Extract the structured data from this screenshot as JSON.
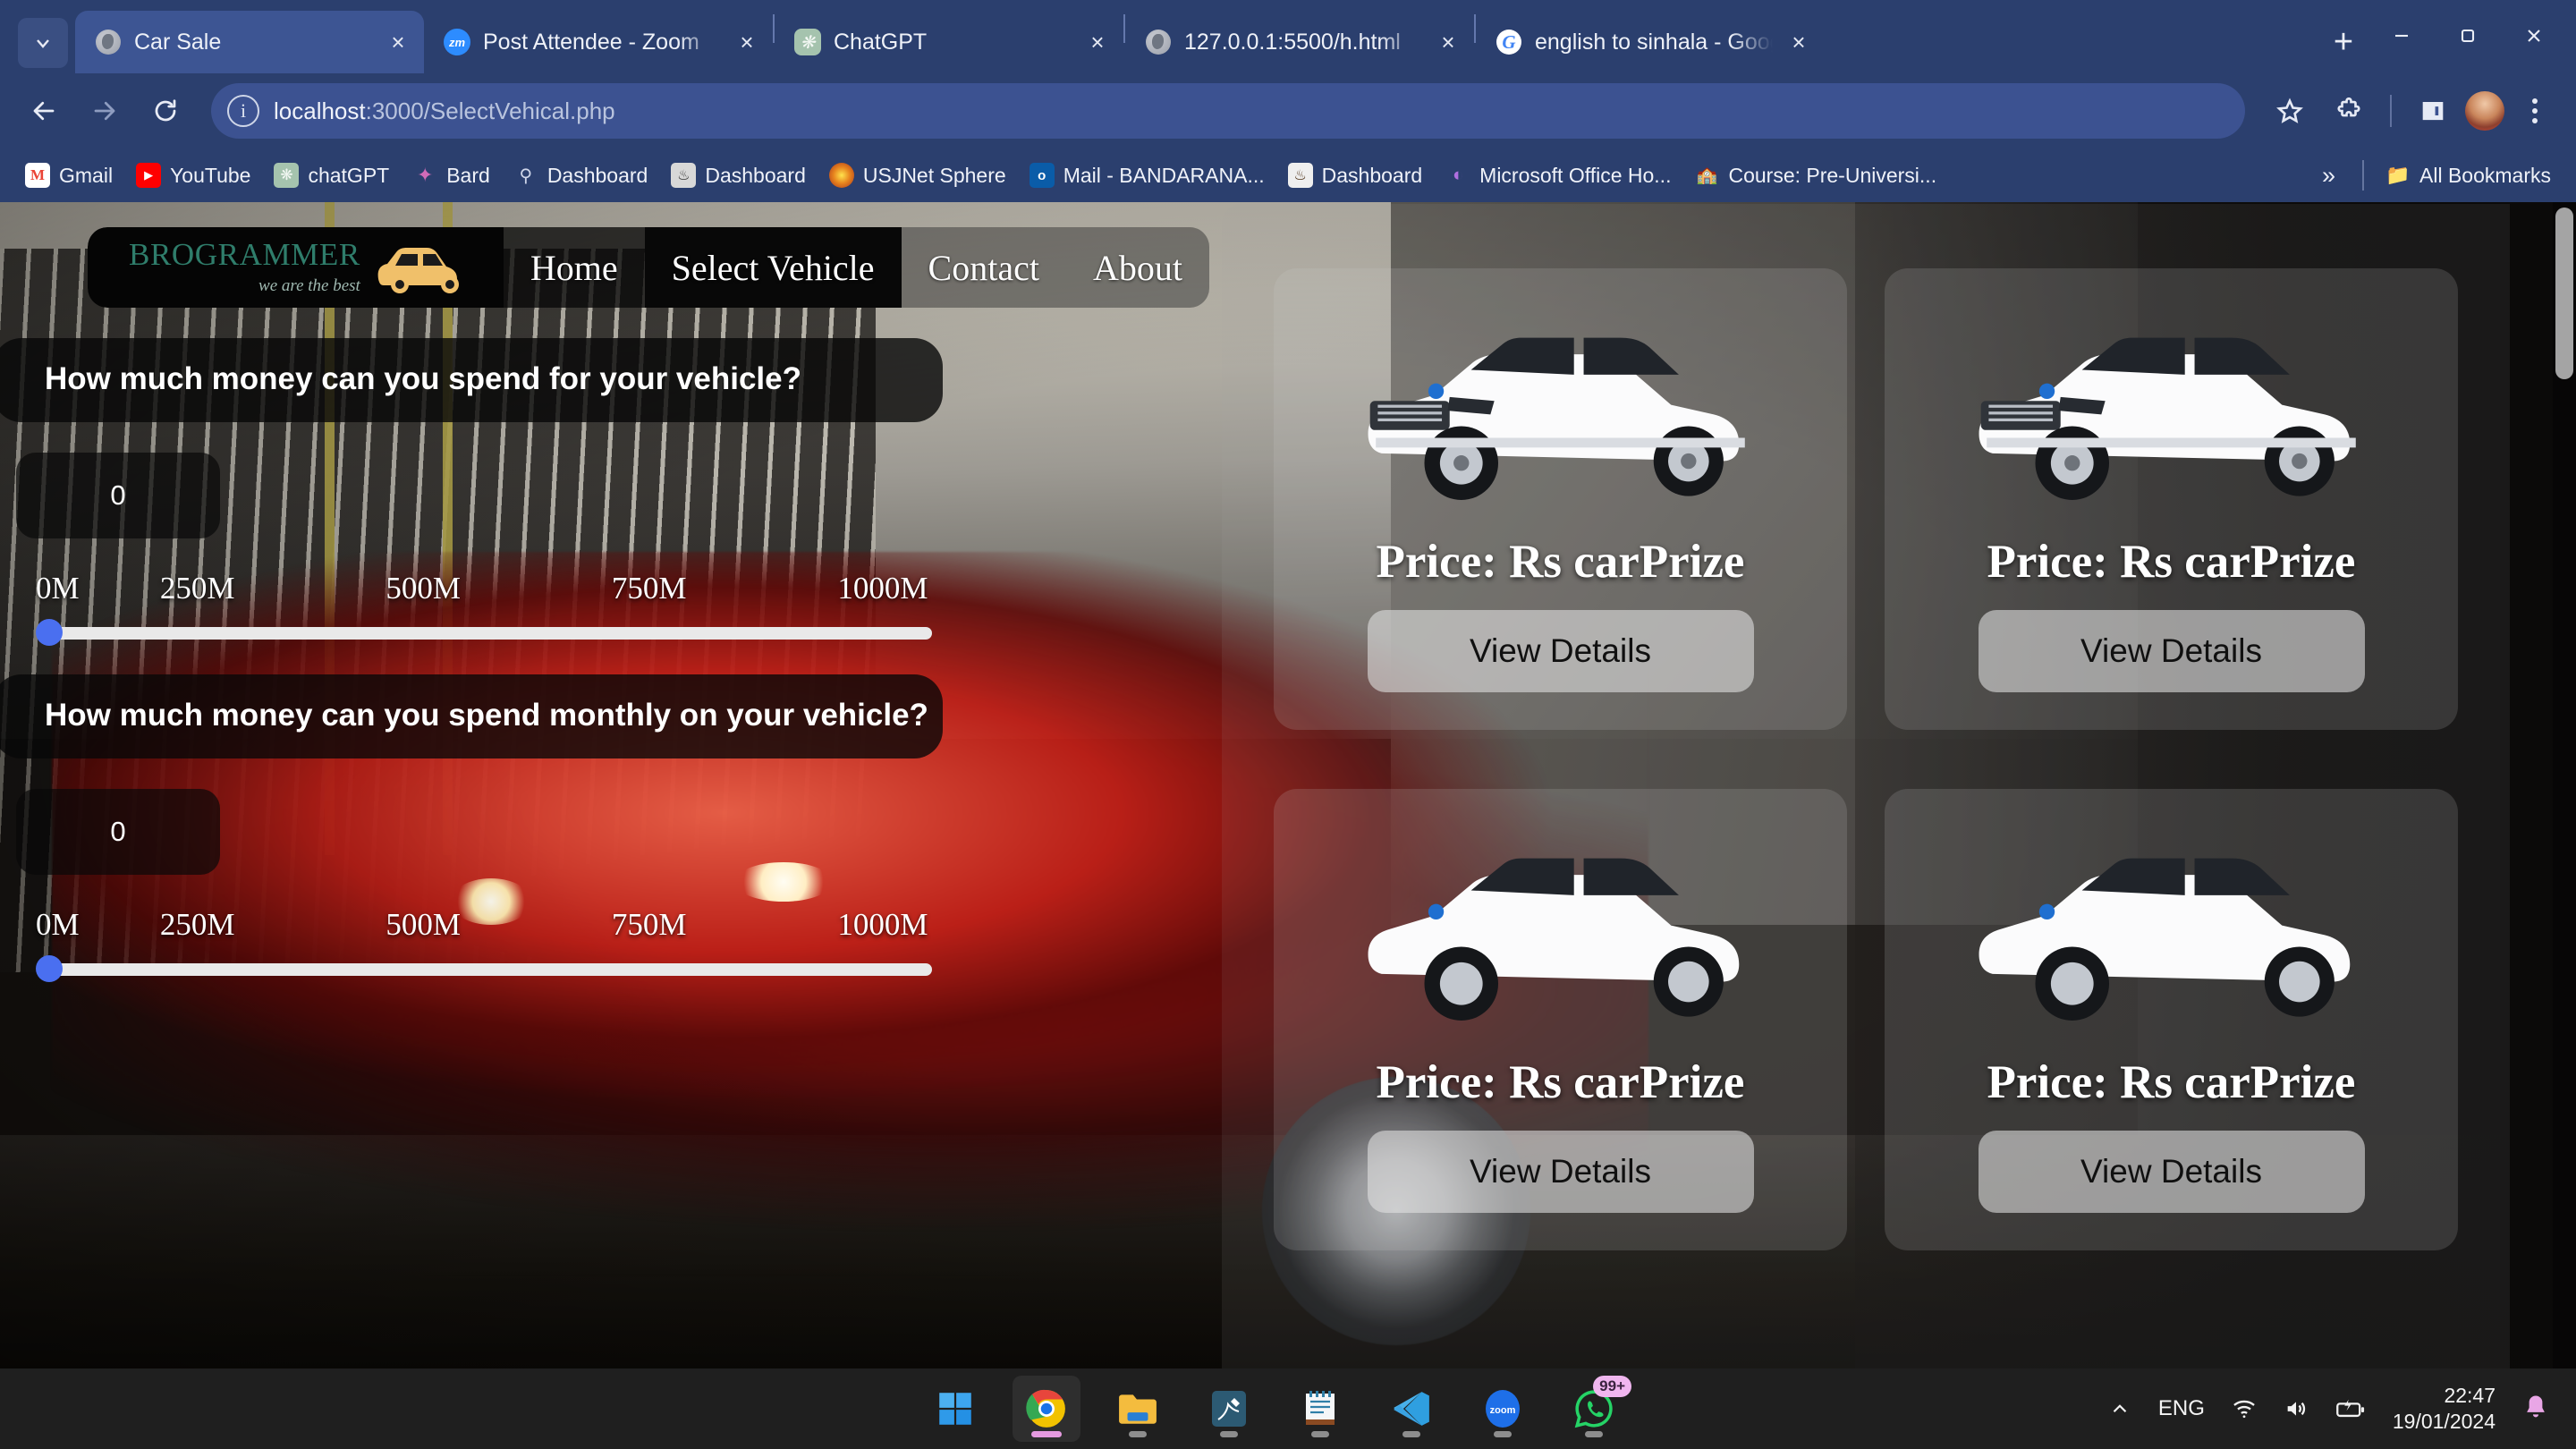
{
  "browser": {
    "tab_search_icon": "chevron-down-icon",
    "tabs": [
      {
        "title": "Car Sale",
        "favicon": "globe-icon",
        "active": true,
        "close_label": "×"
      },
      {
        "title": "Post Attendee - Zoom",
        "favicon": "zoom-icon",
        "active": false,
        "close_label": "×"
      },
      {
        "title": "ChatGPT",
        "favicon": "chatgpt-icon",
        "active": false,
        "close_label": "×"
      },
      {
        "title": "127.0.0.1:5500/h.html",
        "favicon": "globe-icon",
        "active": false,
        "close_label": "×"
      },
      {
        "title": "english to sinhala - Google Sea",
        "favicon": "google-icon",
        "active": false,
        "close_label": "×"
      }
    ],
    "new_tab_label": "+",
    "window_controls": {
      "minimize": "minimize-icon",
      "maximize": "restore-icon",
      "close": "close-icon"
    },
    "toolbar": {
      "back_icon": "arrow-left-icon",
      "forward_icon": "arrow-right-icon",
      "reload_icon": "reload-icon",
      "site_info_icon": "info-icon",
      "url_host": "localhost",
      "url_rest": ":3000/SelectVehical.php",
      "url_full": "localhost:3000/SelectVehical.php",
      "bookmark_icon": "star-icon",
      "extensions_icon": "puzzle-icon",
      "sidepanel_icon": "side-panel-icon",
      "avatar_icon": "profile-avatar",
      "menu_icon": "kebab-menu-icon"
    },
    "bookmarks": [
      {
        "label": "Gmail",
        "icon": "gmail-icon"
      },
      {
        "label": "YouTube",
        "icon": "youtube-icon"
      },
      {
        "label": "chatGPT",
        "icon": "chatgpt-icon"
      },
      {
        "label": "Bard",
        "icon": "bard-icon"
      },
      {
        "label": "Dashboard",
        "icon": "dashboard-icon"
      },
      {
        "label": "Dashboard",
        "icon": "dashboard-icon"
      },
      {
        "label": "USJNet Sphere",
        "icon": "usjnet-icon"
      },
      {
        "label": "Mail - BANDARANA...",
        "icon": "outlook-icon"
      },
      {
        "label": "Dashboard",
        "icon": "dashboard-icon"
      },
      {
        "label": "Microsoft Office Ho...",
        "icon": "office-icon"
      },
      {
        "label": "Course: Pre-Universi...",
        "icon": "course-icon"
      }
    ],
    "bookmarks_overflow": "»",
    "all_bookmarks_label": "All Bookmarks",
    "all_bookmarks_icon": "folder-icon"
  },
  "site": {
    "brand": {
      "name": "BROGRAMMER",
      "tagline": "we are the best",
      "logo_icon": "car-logo-icon"
    },
    "nav": [
      {
        "label": "Home",
        "active": false
      },
      {
        "label": "Select Vehicle",
        "active": true
      },
      {
        "label": "Contact",
        "active": false
      },
      {
        "label": "About",
        "active": false
      }
    ],
    "filters": [
      {
        "question": "How much money can you spend for your vehicle?",
        "value": "0",
        "ticks": [
          "0M",
          "250M",
          "500M",
          "750M",
          "1000M"
        ],
        "slider": {
          "min": 0,
          "max": 1000,
          "value": 0,
          "percent": 0
        }
      },
      {
        "question": "How much money can you spend monthly on your vehicle?",
        "value": "0",
        "ticks": [
          "0M",
          "250M",
          "500M",
          "750M",
          "1000M"
        ],
        "slider": {
          "min": 0,
          "max": 1000,
          "value": 0,
          "percent": 0
        }
      }
    ],
    "cards": [
      {
        "price": "Price: Rs carPrize",
        "button": "View Details",
        "image": "white-suv-image"
      },
      {
        "price": "Price: Rs carPrize",
        "button": "View Details",
        "image": "white-suv-image"
      },
      {
        "price": "Price: Rs carPrize",
        "button": "View Details",
        "image": "white-suv-image"
      },
      {
        "price": "Price: Rs carPrize",
        "button": "View Details",
        "image": "white-suv-image"
      }
    ],
    "scrollbar": {
      "position": "top"
    }
  },
  "taskbar": {
    "apps": [
      {
        "name": "start",
        "label": "Windows Start",
        "running": false
      },
      {
        "name": "chrome",
        "label": "Google Chrome",
        "running": true
      },
      {
        "name": "explorer",
        "label": "File Explorer",
        "running": false
      },
      {
        "name": "mysql-workbench",
        "label": "MySQL Workbench",
        "running": false
      },
      {
        "name": "notepad",
        "label": "Notepad",
        "running": false
      },
      {
        "name": "vscode",
        "label": "Visual Studio Code",
        "running": false
      },
      {
        "name": "zoom",
        "label": "Zoom",
        "running": false,
        "text": "zoom"
      },
      {
        "name": "whatsapp",
        "label": "WhatsApp",
        "running": false,
        "badge": "99+"
      }
    ],
    "tray": {
      "overflow_icon": "chevron-up-icon",
      "language": "ENG",
      "wifi_icon": "wifi-icon",
      "volume_icon": "volume-icon",
      "battery_icon": "battery-charging-icon",
      "time": "22:47",
      "date": "19/01/2024",
      "notification_icon": "bell-icon"
    }
  },
  "colors": {
    "chrome_frame": "#2b3f6e",
    "chrome_tab_active": "#3d5593",
    "omnibox": "#3c5291",
    "brand_green": "#2f7d6b",
    "logo_yellow": "#f0c06a",
    "slider_thumb": "#4a6ff0",
    "slider_track": "#e9e9e9",
    "taskbar": "#1f1f1f",
    "badge_pink": "#f0b6ef"
  }
}
